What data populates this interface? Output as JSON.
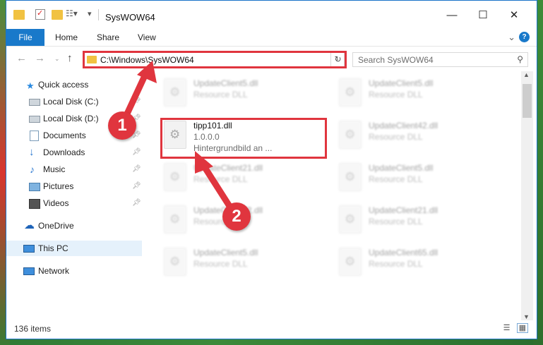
{
  "window": {
    "title": "SysWOW64",
    "controls": {
      "minimize": "—",
      "maximize": "☐",
      "close": "✕"
    }
  },
  "ribbon": {
    "tabs": [
      "File",
      "Home",
      "Share",
      "View"
    ],
    "help": "?"
  },
  "navigation": {
    "address": "C:\\Windows\\SysWOW64",
    "search_placeholder": "Search SysWOW64"
  },
  "sidebar": {
    "items": [
      {
        "label": "Quick access",
        "icon": "star-icon",
        "pinned": false
      },
      {
        "label": "Local Disk (C:)",
        "icon": "drive-icon",
        "pinned": true
      },
      {
        "label": "Local Disk (D:)",
        "icon": "drive-icon",
        "pinned": true
      },
      {
        "label": "Documents",
        "icon": "documents-icon",
        "pinned": true
      },
      {
        "label": "Downloads",
        "icon": "downloads-icon",
        "pinned": true
      },
      {
        "label": "Music",
        "icon": "music-icon",
        "pinned": true
      },
      {
        "label": "Pictures",
        "icon": "pictures-icon",
        "pinned": true
      },
      {
        "label": "Videos",
        "icon": "videos-icon",
        "pinned": true
      },
      {
        "label": "OneDrive",
        "icon": "onedrive-icon",
        "pinned": false
      },
      {
        "label": "This PC",
        "icon": "this-pc-icon",
        "pinned": false,
        "selected": true
      },
      {
        "label": "Network",
        "icon": "network-icon",
        "pinned": false
      }
    ]
  },
  "files": [
    {
      "name": "UpdateClient5.dll",
      "type": "Resource DLL"
    },
    {
      "name": "UpdateClient5.dll",
      "type": "Resource DLL"
    },
    {
      "name": "tipp101.dll",
      "version": "1.0.0.0",
      "description": "Hintergrundbild an ..."
    },
    {
      "name": "UpdateClient42.dll",
      "type": "Resource DLL"
    },
    {
      "name": "UpdateClient21.dll",
      "type": "Resource DLL"
    },
    {
      "name": "UpdateClient5.dll",
      "type": "Resource DLL"
    },
    {
      "name": "UpdateClient42.dll",
      "type": "Resource DLL"
    },
    {
      "name": "UpdateClient21.dll",
      "type": "Resource DLL"
    },
    {
      "name": "UpdateClient5.dll",
      "type": "Resource DLL"
    },
    {
      "name": "UpdateClient65.dll",
      "type": "Resource DLL"
    }
  ],
  "status": {
    "item_count": "136 items"
  },
  "annotations": {
    "step1": "1",
    "step2": "2"
  },
  "colors": {
    "accent": "#1979ca",
    "highlight": "#e0353e"
  }
}
